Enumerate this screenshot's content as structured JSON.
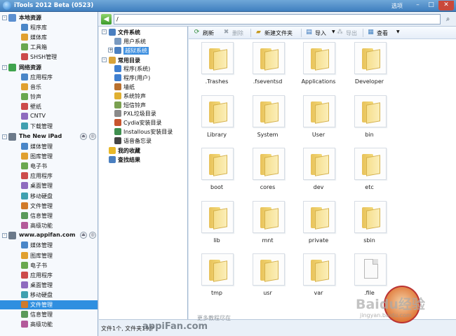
{
  "window": {
    "title": "iTools 2012 Beta (0523)",
    "options_label": "选项",
    "minimize": "–",
    "maximize": "□",
    "close": "✕"
  },
  "sidebar": {
    "sections": [
      {
        "label": "本地资源",
        "collapse": "-",
        "items": [
          "程序库",
          "媒体库",
          "工具箱",
          "SHSH管理"
        ]
      },
      {
        "label": "网络资源",
        "collapse": "-",
        "items": [
          "应用程序",
          "音乐",
          "铃声",
          "壁纸",
          "CNTV",
          "下载管理"
        ]
      },
      {
        "label": "The New iPad",
        "collapse": "-",
        "items": [
          "媒体管理",
          "图库管理",
          "电子书",
          "应用程序",
          "桌面管理",
          "移动硬盘",
          "文件管理",
          "信息管理",
          "高级功能"
        ]
      },
      {
        "label": "www.appifan.com",
        "collapse": "-",
        "items": [
          "媒体管理",
          "图库管理",
          "电子书",
          "应用程序",
          "桌面管理",
          "移动硬盘",
          "文件管理",
          "信息管理",
          "高级功能"
        ]
      }
    ],
    "selected_item": "文件管理"
  },
  "address": {
    "back_icon": "back-arrow-icon",
    "path": "/",
    "search_icon": "search-icon"
  },
  "tree": {
    "items": [
      {
        "label": "文件系统",
        "bold": true,
        "toggle": "-",
        "level": 0
      },
      {
        "label": "用户系统",
        "level": 1
      },
      {
        "label": "越狱系统",
        "toggle": "+",
        "level": 1,
        "selected": true
      },
      {
        "label": "常用目录",
        "bold": true,
        "toggle": "-",
        "level": 0
      },
      {
        "label": "程序(系统)",
        "level": 1
      },
      {
        "label": "程序(用户)",
        "level": 1
      },
      {
        "label": "墙纸",
        "level": 1
      },
      {
        "label": "系统铃声",
        "level": 1
      },
      {
        "label": "短信铃声",
        "level": 1
      },
      {
        "label": "PXL垃圾目录",
        "level": 1
      },
      {
        "label": "Cydia安装目录",
        "level": 1
      },
      {
        "label": "Installous安装目录",
        "level": 1
      },
      {
        "label": "语音备忘录",
        "level": 1
      },
      {
        "label": "我的收藏",
        "bold": true,
        "level": 0
      },
      {
        "label": "查找结果",
        "bold": true,
        "level": 0
      }
    ]
  },
  "toolbar": {
    "refresh": "刷新",
    "delete": "删除",
    "new_folder": "新建文件夹",
    "import": "导入",
    "export": "导出",
    "view": "查看"
  },
  "files": [
    {
      "name": ".Trashes",
      "type": "folder"
    },
    {
      "name": ".fseventsd",
      "type": "folder"
    },
    {
      "name": "Applications",
      "type": "folder"
    },
    {
      "name": "Developer",
      "type": "folder"
    },
    {
      "name": "Library",
      "type": "folder"
    },
    {
      "name": "System",
      "type": "folder"
    },
    {
      "name": "User",
      "type": "folder"
    },
    {
      "name": "bin",
      "type": "folder"
    },
    {
      "name": "boot",
      "type": "folder"
    },
    {
      "name": "cores",
      "type": "folder"
    },
    {
      "name": "dev",
      "type": "folder"
    },
    {
      "name": "etc",
      "type": "folder"
    },
    {
      "name": "lib",
      "type": "folder"
    },
    {
      "name": "mnt",
      "type": "folder"
    },
    {
      "name": "private",
      "type": "folder"
    },
    {
      "name": "sbin",
      "type": "folder"
    },
    {
      "name": "tmp",
      "type": "folder"
    },
    {
      "name": "usr",
      "type": "folder"
    },
    {
      "name": "var",
      "type": "folder"
    },
    {
      "name": ".file",
      "type": "file"
    }
  ],
  "status": {
    "text": "文件1个, 文件夹19个"
  },
  "watermarks": {
    "site": "appiFan.com",
    "site_note": "更多教程尽在",
    "baidu": "Baidu经验",
    "baidu_url": "jingyan.baidu.com"
  },
  "colors": {
    "selected_bg": "#2f8fe0",
    "titlebar": "#3f7fbf",
    "folder": "#f3d979"
  }
}
